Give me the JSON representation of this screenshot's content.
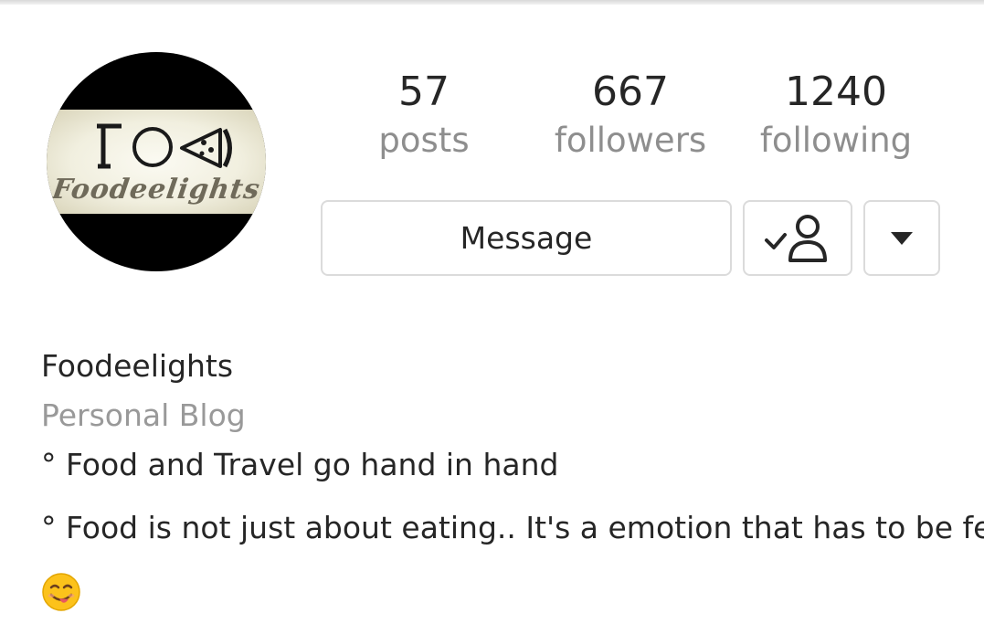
{
  "profile": {
    "avatar_logo_text": "ΓΟ◁",
    "avatar_script_text": "Foodeelights",
    "avatar_icon": "foodeelights-logo"
  },
  "stats": {
    "posts": {
      "value": "57",
      "label": "posts"
    },
    "followers": {
      "value": "667",
      "label": "followers"
    },
    "following": {
      "value": "1240",
      "label": "following"
    }
  },
  "actions": {
    "message_label": "Message",
    "following_icon": "person-check-icon",
    "dropdown_icon": "caret-down-icon"
  },
  "bio": {
    "name": "Foodeelights",
    "category": "Personal Blog",
    "lines": [
      "° Food and Travel go hand in hand",
      "° Food is not just about eating.. It's a emotion that has to be felt"
    ],
    "emoji_icon": "yum-face-emoji"
  },
  "colors": {
    "text_primary": "#262626",
    "text_secondary": "#8e8e8e",
    "border": "#dbdbdb",
    "emoji_face": "#fcc21b"
  }
}
